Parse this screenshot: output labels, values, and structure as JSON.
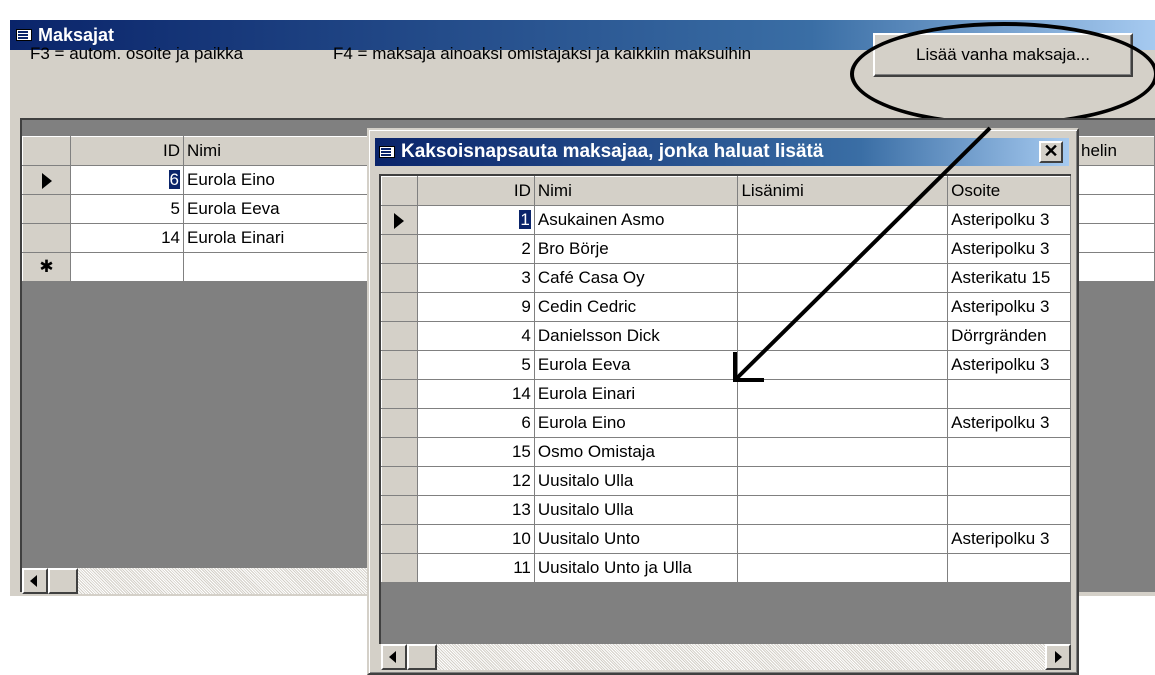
{
  "main": {
    "title": "Maksajat",
    "hint1": "F3 = autom. osoite ja paikka",
    "hint2": "F4 = maksaja ainoaksi omistajaksi ja kaikkiin maksuihin",
    "add_button": "Lisää vanha maksaja...",
    "columns": {
      "id": "ID",
      "name": "Nimi",
      "phone_partial": "helin"
    },
    "current_id_partial": "6",
    "rows": [
      {
        "id": "5",
        "name": "Eurola Eeva"
      },
      {
        "id": "14",
        "name": "Eurola Einari"
      }
    ],
    "first_row_name": "Eurola Eino",
    "new_row_marker": "✱"
  },
  "popup": {
    "title": "Kaksoisnapsauta maksajaa, jonka haluat lisätä",
    "close": "✕",
    "columns": {
      "id": "ID",
      "name": "Nimi",
      "extra": "Lisänimi",
      "address": "Osoite"
    },
    "rows": [
      {
        "id": "1",
        "name": "Asukainen Asmo",
        "extra": "",
        "address": "Asteripolku 3"
      },
      {
        "id": "2",
        "name": "Bro Börje",
        "extra": "",
        "address": "Asteripolku 3"
      },
      {
        "id": "3",
        "name": "Café Casa Oy",
        "extra": "",
        "address": "Asterikatu 15"
      },
      {
        "id": "9",
        "name": "Cedin Cedric",
        "extra": "",
        "address": "Asteripolku 3"
      },
      {
        "id": "4",
        "name": "Danielsson Dick",
        "extra": "",
        "address": "Dörrgränden"
      },
      {
        "id": "5",
        "name": "Eurola Eeva",
        "extra": "",
        "address": "Asteripolku 3"
      },
      {
        "id": "14",
        "name": "Eurola Einari",
        "extra": "",
        "address": ""
      },
      {
        "id": "6",
        "name": "Eurola Eino",
        "extra": "",
        "address": "Asteripolku 3"
      },
      {
        "id": "15",
        "name": "Osmo Omistaja",
        "extra": "",
        "address": ""
      },
      {
        "id": "12",
        "name": "Uusitalo Ulla",
        "extra": "",
        "address": ""
      },
      {
        "id": "13",
        "name": "Uusitalo Ulla",
        "extra": "",
        "address": ""
      },
      {
        "id": "10",
        "name": "Uusitalo Unto",
        "extra": "",
        "address": "Asteripolku 3"
      },
      {
        "id": "11",
        "name": "Uusitalo Unto ja Ulla",
        "extra": "",
        "address": ""
      }
    ]
  },
  "icons": {
    "title_icon": "form-icon",
    "current_row": "current-record-icon"
  }
}
